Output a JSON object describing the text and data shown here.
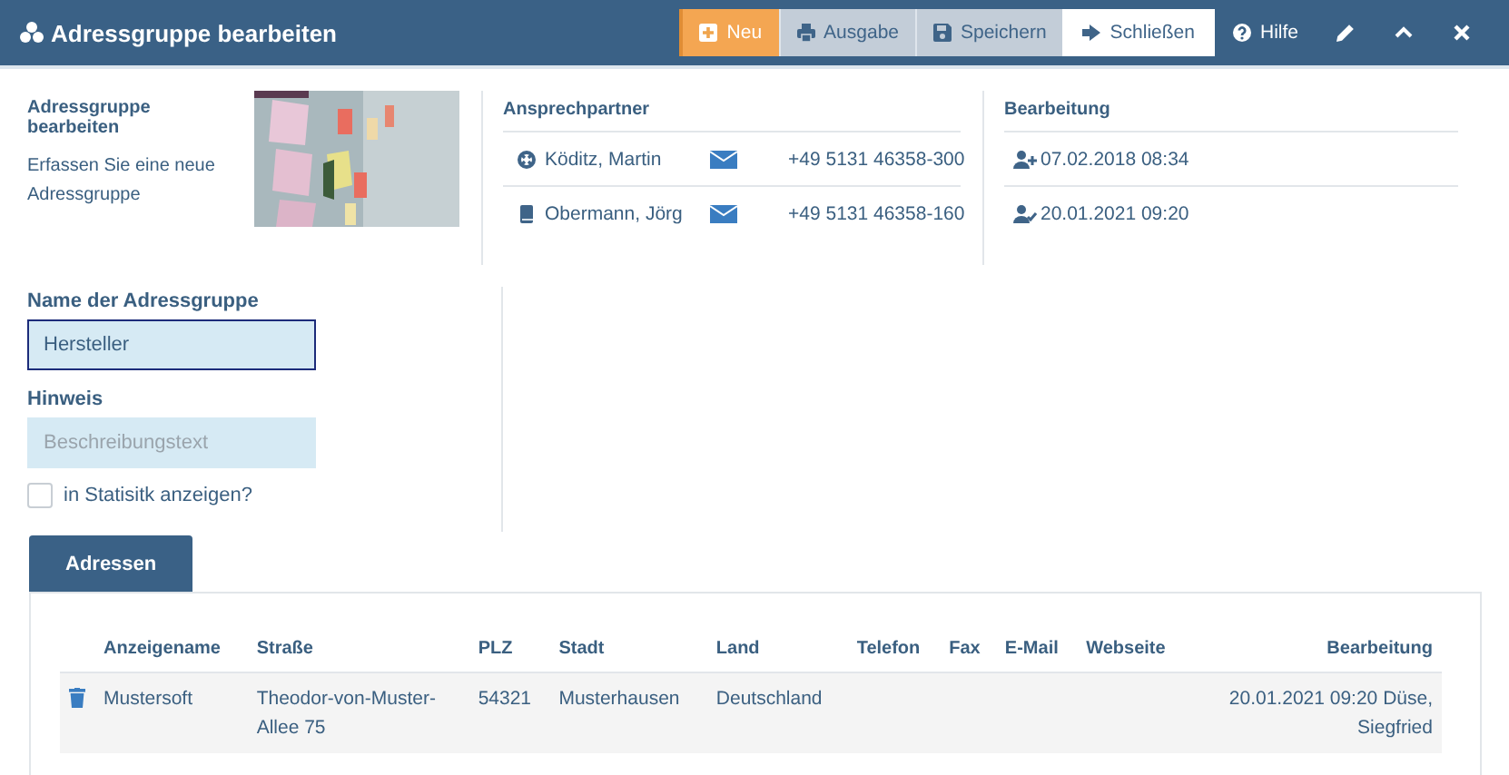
{
  "window": {
    "title": "Adressgruppe bearbeiten"
  },
  "toolbar": [
    {
      "kind": "new",
      "label": "Neu"
    },
    {
      "kind": "print",
      "label": "Ausgabe"
    },
    {
      "kind": "save",
      "label": "Speichern"
    },
    {
      "kind": "exit",
      "label": "Schließen"
    },
    {
      "kind": "help",
      "label": "Hilfe"
    },
    {
      "kind": "edit"
    },
    {
      "kind": "collapse"
    },
    {
      "kind": "close"
    }
  ],
  "intro": {
    "title": "Adressgruppe bearbeiten",
    "text": "Erfassen Sie eine neue Adressgruppe"
  },
  "contacts": {
    "heading": "Ansprechpartner",
    "rows": [
      {
        "kind": "support",
        "name": "Köditz, Martin",
        "phone": "+49 5131 46358-300"
      },
      {
        "kind": "book",
        "name": "Obermann, Jörg",
        "phone": "+49 5131 46358-160"
      }
    ]
  },
  "history": {
    "heading": "Bearbeitung",
    "rows": [
      {
        "kind": "created",
        "date": "07.02.2018 08:34"
      },
      {
        "kind": "modified",
        "date": "20.01.2021 09:20"
      }
    ]
  },
  "form": {
    "name_label": "Name der Adressgruppe",
    "name_value": "Hersteller",
    "note_label": "Hinweis",
    "note_placeholder": "Beschreibungstext",
    "stats_label": "in Statisitk anzeigen?",
    "stats_checked": false
  },
  "tabs": [
    {
      "label": "Adressen",
      "selected": true
    }
  ],
  "table": {
    "columns": [
      "Anzeigename",
      "Straße",
      "PLZ",
      "Stadt",
      "Land",
      "Telefon",
      "Fax",
      "E-Mail",
      "Webseite",
      "Bearbeitung"
    ],
    "rows": [
      [
        "Mustersoft",
        "Theodor-von-Muster-Allee 75",
        "54321",
        "Musterhausen",
        "Deutschland",
        "",
        "",
        "",
        "",
        "20.01.2021 09:20 Düse, Siegfried"
      ]
    ]
  }
}
